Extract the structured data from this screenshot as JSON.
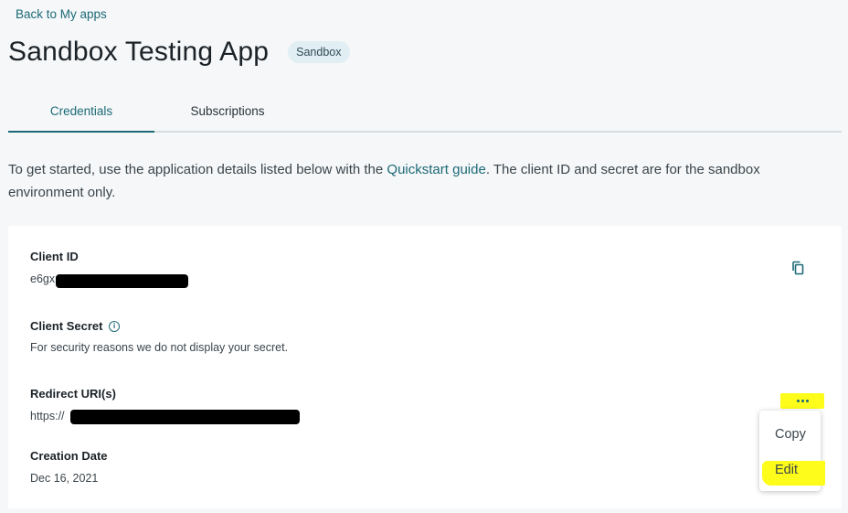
{
  "nav": {
    "back_label": "Back to My apps"
  },
  "header": {
    "title": "Sandbox Testing App",
    "badge": "Sandbox"
  },
  "tabs": [
    {
      "label": "Credentials",
      "active": true
    },
    {
      "label": "Subscriptions",
      "active": false
    }
  ],
  "intro": {
    "before": "To get started, use the application details listed below with the ",
    "link": "Quickstart guide",
    "after": ". The client ID and secret are for the sandbox environment only."
  },
  "credentials": {
    "client_id": {
      "label": "Client ID",
      "value_prefix": "e6gx"
    },
    "client_secret": {
      "label": "Client Secret",
      "note": "For security reasons we do not display your secret."
    },
    "redirect_uris": {
      "label": "Redirect URI(s)",
      "value_prefix": "https://"
    },
    "creation_date": {
      "label": "Creation Date",
      "value": "Dec 16, 2021"
    }
  },
  "menu": {
    "items": [
      "Copy",
      "Edit"
    ]
  },
  "icons": {
    "copy": "copy-icon",
    "info": "info-icon",
    "more": "more-horizontal-icon"
  },
  "colors": {
    "accent": "#1c6a77",
    "highlight": "#fdfc1a",
    "redaction": "#000000"
  }
}
